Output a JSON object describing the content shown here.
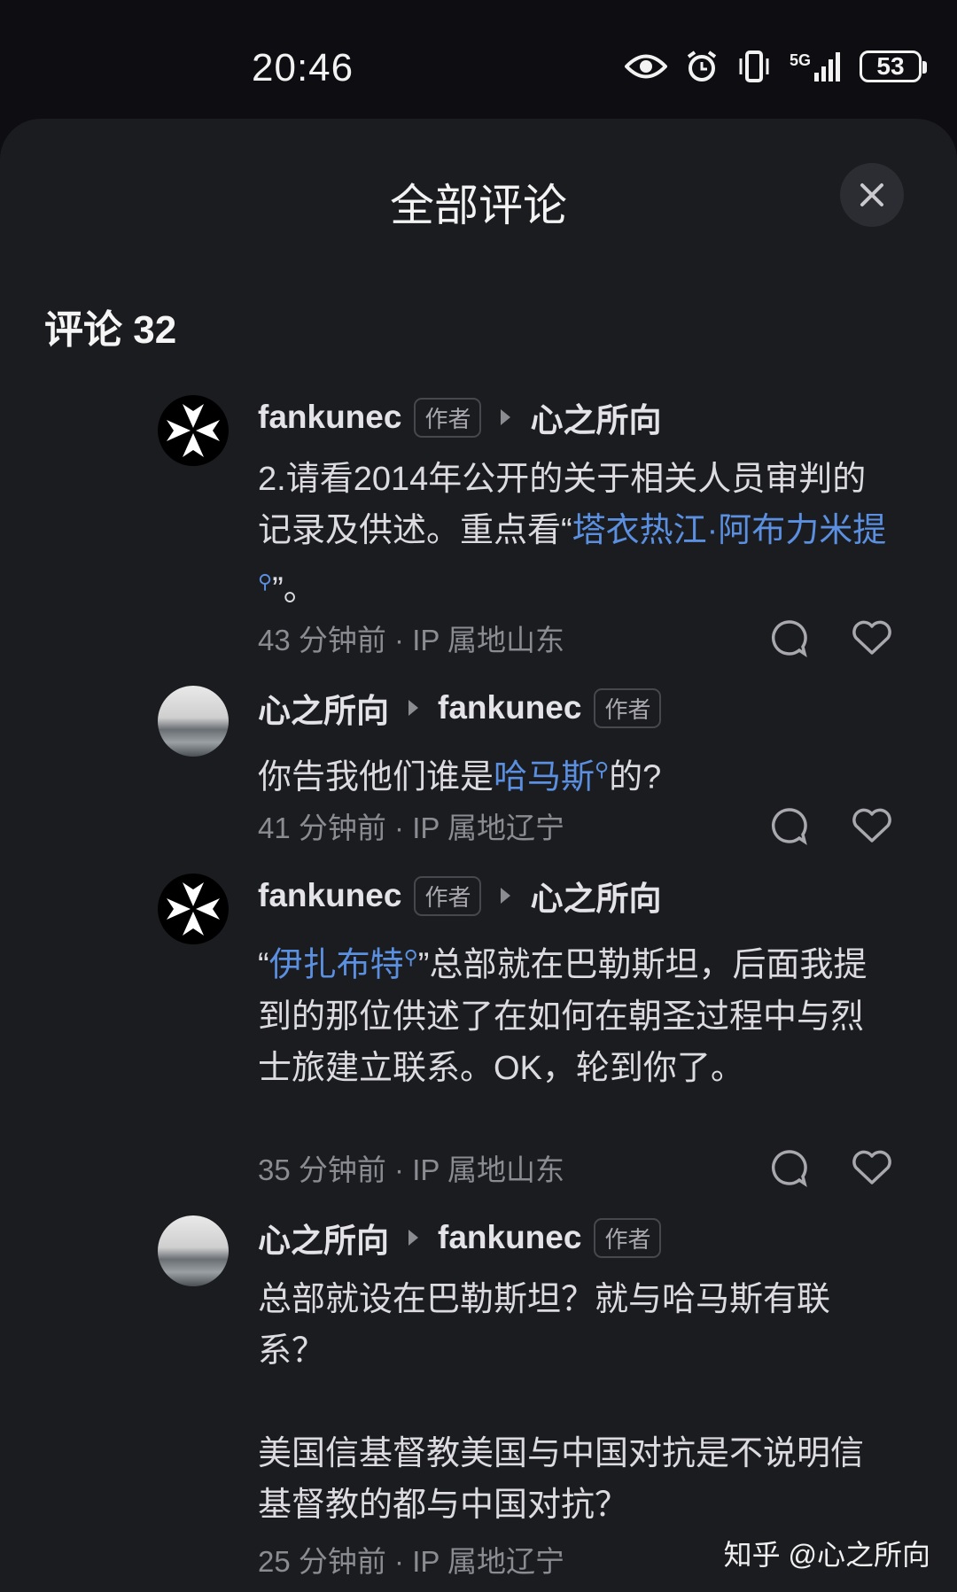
{
  "status_bar": {
    "time": "20:46",
    "signal_label": "5G",
    "battery": "53",
    "icons": [
      "eye-icon",
      "alarm-icon",
      "vibrate-icon",
      "5g-signal-icon",
      "battery-icon"
    ]
  },
  "sheet": {
    "title": "全部评论",
    "comment_count_label": "评论 32"
  },
  "comments": [
    {
      "author": "fankunec",
      "author_badge": "作者",
      "reply_to": "心之所向",
      "reply_to_badge": "",
      "text_before": "2.请看2014年公开的关于相关人员审判的记录及供述。重点看“",
      "link": "塔衣热江·阿布力米提",
      "text_after": "”。",
      "time": "43 分钟前",
      "ip": "IP 属地山东"
    },
    {
      "author": "心之所向",
      "author_badge": "",
      "reply_to": "fankunec",
      "reply_to_badge": "作者",
      "text_before": "你告我他们谁是",
      "link": "哈马斯",
      "text_after": "的?",
      "time": "41 分钟前",
      "ip": "IP 属地辽宁"
    },
    {
      "author": "fankunec",
      "author_badge": "作者",
      "reply_to": "心之所向",
      "reply_to_badge": "",
      "text_before": "“",
      "link": "伊扎布特",
      "text_after": "”总部就在巴勒斯坦，后面我提到的那位供述了在如何在朝圣过程中与烈士旅建立联系。OK，轮到你了。",
      "time": "35 分钟前",
      "ip": "IP 属地山东"
    },
    {
      "author": "心之所向",
      "author_badge": "",
      "reply_to": "fankunec",
      "reply_to_badge": "作者",
      "text_line1": "总部就设在巴勒斯坦？就与哈马斯有联系？",
      "text_line2": "美国信基督教美国与中国对抗是不说明信基督教的都与中国对抗？",
      "time": "25 分钟前",
      "ip": "IP 属地辽宁"
    }
  ],
  "meta_separator": "·",
  "watermark": "知乎 @心之所向",
  "colors": {
    "background": "#1b1c20",
    "link": "#5b8fe0",
    "text": "#dcdce0",
    "meta": "#8b8b92"
  }
}
